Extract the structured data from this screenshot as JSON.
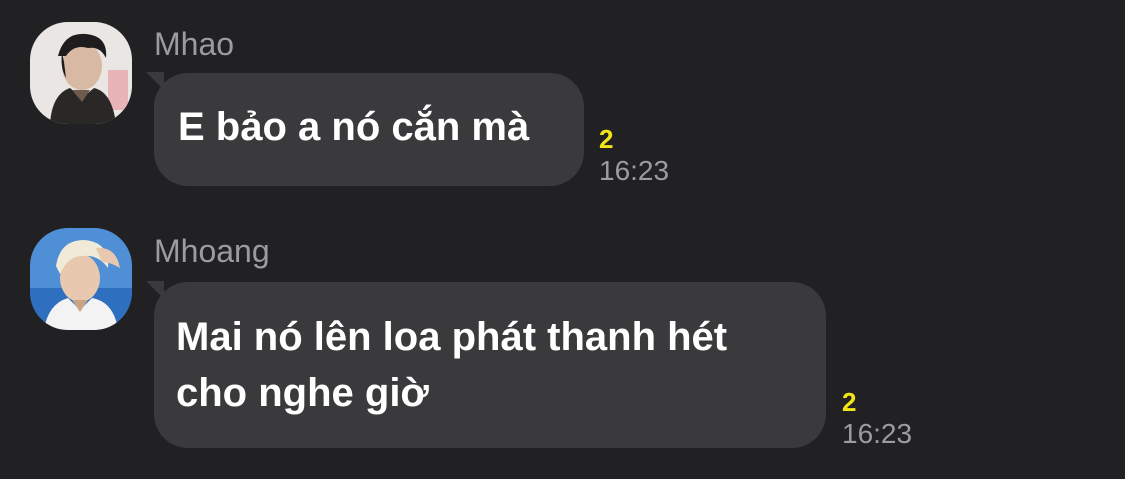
{
  "messages": [
    {
      "sender": "Mhao",
      "avatar_icon": "user-avatar-photo",
      "text": "E bảo a nó cắn mà",
      "unread_count": "2",
      "time": "16:23"
    },
    {
      "sender": "Mhoang",
      "avatar_icon": "user-avatar-photo",
      "text_line1": "Mai nó lên loa phát thanh hét",
      "text_line2": "cho nghe giờ",
      "unread_count": "2",
      "time": "16:23"
    }
  ],
  "colors": {
    "background": "#212124",
    "bubble": "#3a3a3c",
    "sender_name": "#9b9ba0",
    "unread_badge": "#f2e516",
    "message_text": "#ffffff"
  }
}
